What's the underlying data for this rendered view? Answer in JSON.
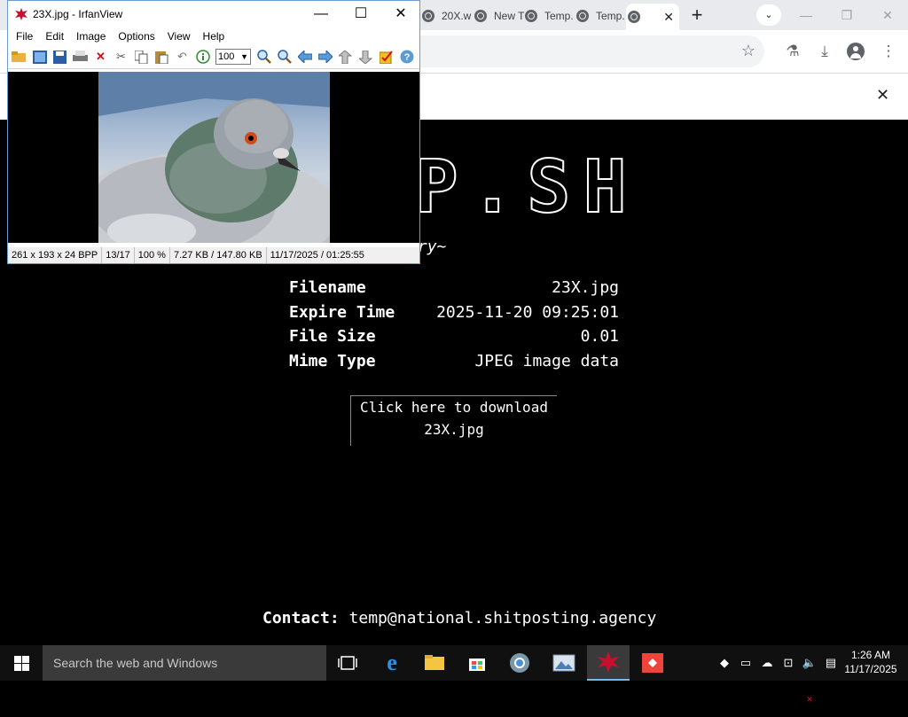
{
  "chrome": {
    "tabs": [
      {
        "label": "20X.w",
        "active": false
      },
      {
        "label": "New T",
        "active": false
      },
      {
        "label": "Temp.",
        "active": false
      },
      {
        "label": "Temp.",
        "active": false
      },
      {
        "label": "",
        "active": true
      }
    ],
    "active_tab_close": "✕",
    "new_tab": "+",
    "tab_search": "⌄",
    "win_minimize": "—",
    "win_restore": "❐",
    "win_close": "✕",
    "infobar_close": "✕"
  },
  "page": {
    "big_title": "mP.SH",
    "tagline": "ng is temporary~",
    "fields": [
      {
        "label": "Filename",
        "value": "23X.jpg"
      },
      {
        "label": "Expire Time",
        "value": "2025-11-20 09:25:01"
      },
      {
        "label": "File Size",
        "value": "0.01"
      },
      {
        "label": "Mime Type",
        "value": "JPEG image data"
      }
    ],
    "download_line1": "Click here to download",
    "download_line2": "23X.jpg",
    "contact_label": "Contact:",
    "contact_email": "temp@national.shitposting.agency"
  },
  "irfanview": {
    "title": "23X.jpg - IrfanView",
    "menu": [
      "File",
      "Edit",
      "Image",
      "Options",
      "View",
      "Help"
    ],
    "zoom_value": "100",
    "status": {
      "dimensions": "261 x 193 x 24 BPP",
      "index": "13/17",
      "zoom": "100 %",
      "size": "7.27 KB / 147.80 KB",
      "datetime": "11/17/2025 / 01:25:55"
    }
  },
  "taskbar": {
    "search_placeholder": "Search the web and Windows",
    "time": "1:26 AM",
    "date": "11/17/2025"
  }
}
